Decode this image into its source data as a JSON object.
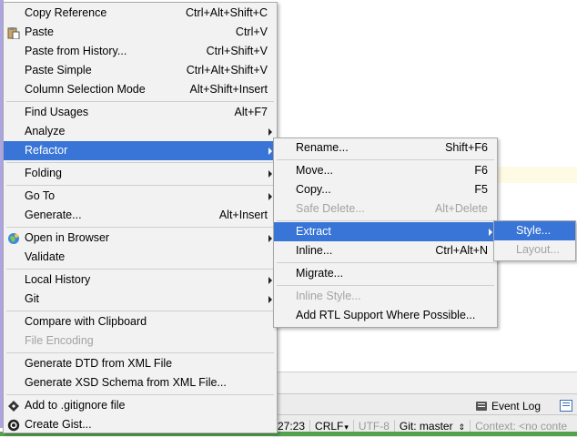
{
  "main_menu": {
    "items": [
      {
        "id": "copy-reference",
        "label": "Copy Reference",
        "shortcut": "Ctrl+Alt+Shift+C"
      },
      {
        "id": "paste",
        "label": "Paste",
        "shortcut": "Ctrl+V",
        "icon": "clipboard-paste-icon"
      },
      {
        "id": "paste-from-history",
        "label": "Paste from History...",
        "shortcut": "Ctrl+Shift+V"
      },
      {
        "id": "paste-simple",
        "label": "Paste Simple",
        "shortcut": "Ctrl+Alt+Shift+V"
      },
      {
        "id": "column-selection-mode",
        "label": "Column Selection Mode",
        "shortcut": "Alt+Shift+Insert"
      },
      {
        "id": "find-usages",
        "label": "Find Usages",
        "shortcut": "Alt+F7"
      },
      {
        "id": "analyze",
        "label": "Analyze",
        "submenu": true
      },
      {
        "id": "refactor",
        "label": "Refactor",
        "submenu": true,
        "selected": true
      },
      {
        "id": "folding",
        "label": "Folding",
        "submenu": true
      },
      {
        "id": "go-to",
        "label": "Go To",
        "submenu": true
      },
      {
        "id": "generate",
        "label": "Generate...",
        "shortcut": "Alt+Insert"
      },
      {
        "id": "open-in-browser",
        "label": "Open in Browser",
        "submenu": true,
        "icon": "globe-icon"
      },
      {
        "id": "validate",
        "label": "Validate"
      },
      {
        "id": "local-history",
        "label": "Local History",
        "submenu": true
      },
      {
        "id": "git",
        "label": "Git",
        "submenu": true
      },
      {
        "id": "compare-with-clipboard",
        "label": "Compare with Clipboard"
      },
      {
        "id": "file-encoding",
        "label": "File Encoding",
        "disabled": true
      },
      {
        "id": "generate-dtd",
        "label": "Generate DTD from XML File"
      },
      {
        "id": "generate-xsd",
        "label": "Generate XSD Schema from XML File..."
      },
      {
        "id": "add-to-gitignore",
        "label": "Add to .gitignore file",
        "icon": "git-diamond-icon"
      },
      {
        "id": "create-gist",
        "label": "Create Gist...",
        "icon": "github-octocat-icon"
      }
    ]
  },
  "refactor_menu": {
    "items": [
      {
        "id": "rename",
        "label": "Rename...",
        "shortcut": "Shift+F6"
      },
      {
        "id": "move",
        "label": "Move...",
        "shortcut": "F6"
      },
      {
        "id": "copy",
        "label": "Copy...",
        "shortcut": "F5"
      },
      {
        "id": "safe-delete",
        "label": "Safe Delete...",
        "shortcut": "Alt+Delete",
        "disabled": true
      },
      {
        "id": "extract",
        "label": "Extract",
        "submenu": true,
        "selected": true
      },
      {
        "id": "inline",
        "label": "Inline...",
        "shortcut": "Ctrl+Alt+N"
      },
      {
        "id": "migrate",
        "label": "Migrate..."
      },
      {
        "id": "inline-style",
        "label": "Inline Style...",
        "disabled": true
      },
      {
        "id": "add-rtl",
        "label": "Add RTL Support Where Possible..."
      }
    ]
  },
  "extract_menu": {
    "items": [
      {
        "id": "style",
        "label": "Style...",
        "selected": true
      },
      {
        "id": "layout",
        "label": "Layout...",
        "disabled": true
      }
    ]
  },
  "toolwindow": {
    "event_log": "Event Log"
  },
  "statusbar": {
    "position": "27:23",
    "line_separator": "CRLF",
    "encoding": "UTF-8",
    "vcs_branch": "Git: master",
    "context": "Context: <no conte"
  },
  "colors": {
    "selection": "#3875d7",
    "menu_bg": "#f2f2f2",
    "disabled": "#a3a3a3"
  }
}
